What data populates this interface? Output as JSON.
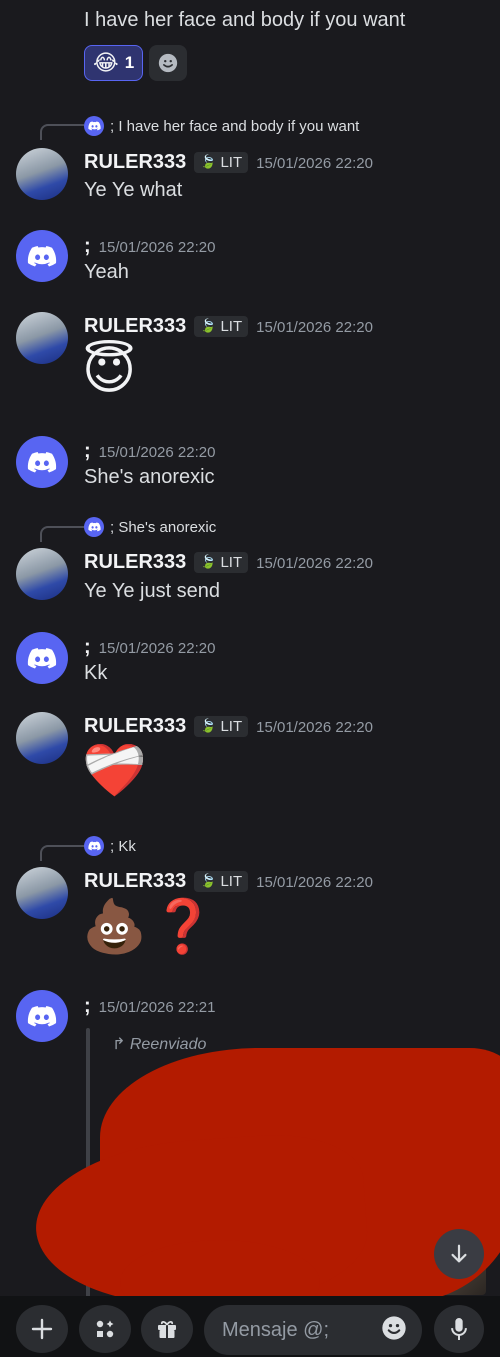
{
  "top_message": {
    "text": "I have her face and body if you want",
    "reaction_count": "1"
  },
  "messages": [
    {
      "reply_text": "; I have her face and body if you want",
      "user": "RULER333",
      "badge": "LIT",
      "time": "15/01/2026 22:20",
      "text": "Ye Ye what"
    },
    {
      "user": ";",
      "time": "15/01/2026 22:20",
      "text": "Yeah"
    },
    {
      "user": "RULER333",
      "badge": "LIT",
      "time": "15/01/2026 22:20",
      "emoji": "😇"
    },
    {
      "user": ";",
      "time": "15/01/2026 22:20",
      "text": "She's anorexic"
    },
    {
      "reply_text": "; She's anorexic",
      "user": "RULER333",
      "badge": "LIT",
      "time": "15/01/2026 22:20",
      "text": "Ye Ye just send"
    },
    {
      "user": ";",
      "time": "15/01/2026 22:20",
      "text": "Kk"
    },
    {
      "user": "RULER333",
      "badge": "LIT",
      "time": "15/01/2026 22:20",
      "emoji": "❤️‍🩹"
    },
    {
      "reply_text": "; Kk",
      "user": "RULER333",
      "badge": "LIT",
      "time": "15/01/2026 22:20",
      "emoji": "💩❓"
    },
    {
      "user": ";",
      "time": "15/01/2026 22:21",
      "forwarded_label": "Reenviado"
    }
  ],
  "composer": {
    "placeholder": "Mensaje @;"
  },
  "colors": {
    "background": "#1a1a1e",
    "discord_blurple": "#5865f2",
    "redaction": "#b31b00"
  },
  "icons": [
    "discord-logo-icon",
    "smile-add-icon",
    "leaf-icon",
    "arrow-down-icon",
    "plus-icon",
    "apps-icon",
    "gift-icon",
    "emoji-icon",
    "mic-icon",
    "forward-icon"
  ]
}
